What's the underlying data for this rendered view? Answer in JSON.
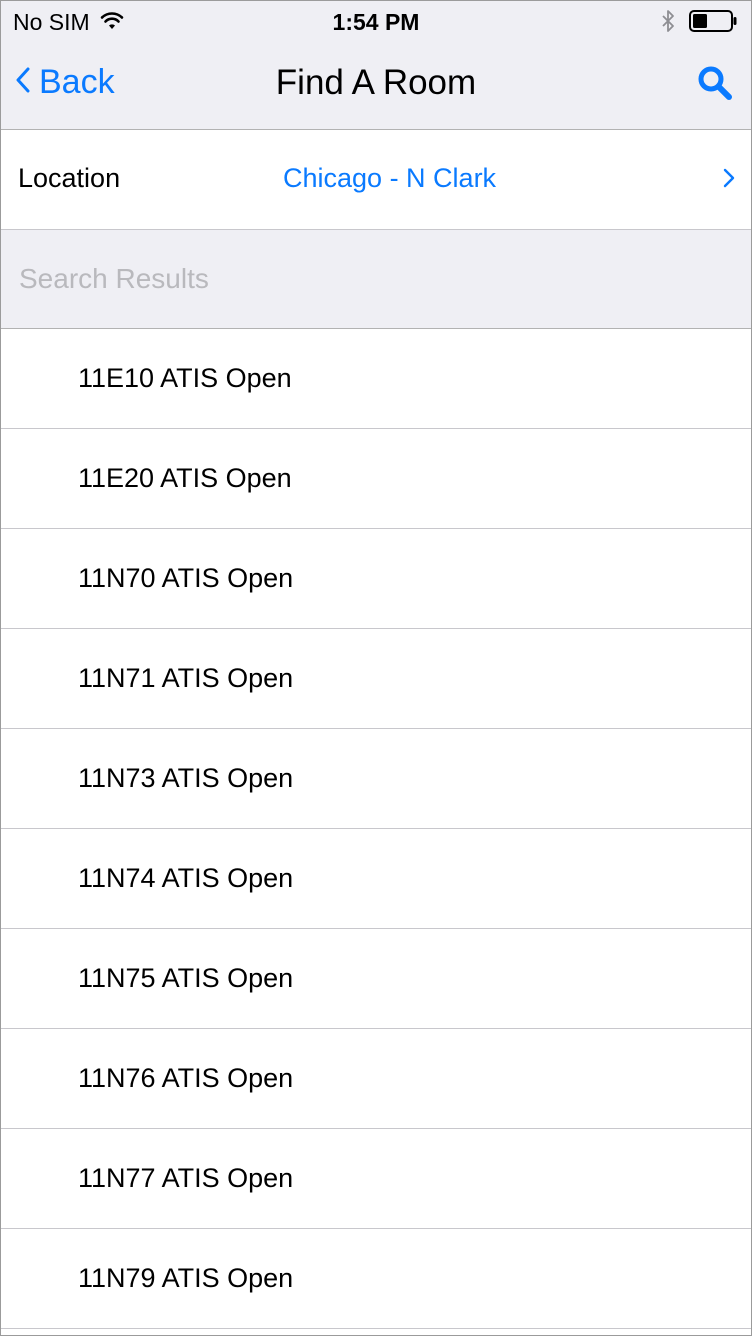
{
  "status_bar": {
    "carrier": "No SIM",
    "time": "1:54 PM"
  },
  "nav": {
    "back_label": "Back",
    "title": "Find A Room"
  },
  "location": {
    "label": "Location",
    "value": "Chicago - N Clark"
  },
  "section": {
    "title": "Search Results"
  },
  "results": [
    "11E10 ATIS Open",
    "11E20 ATIS Open",
    "11N70 ATIS Open",
    "11N71 ATIS Open",
    "11N73 ATIS Open",
    "11N74 ATIS Open",
    "11N75 ATIS Open",
    "11N76 ATIS Open",
    "11N77 ATIS Open",
    "11N79 ATIS Open"
  ],
  "colors": {
    "accent": "#0a7aff",
    "bar_background": "#efeff4",
    "separator": "#c8c7cc"
  },
  "icons": {
    "wifi": "wifi-icon",
    "bluetooth": "bluetooth-icon",
    "battery": "battery-icon",
    "back": "chevron-left-icon",
    "search": "search-icon",
    "disclosure": "chevron-right-icon"
  }
}
